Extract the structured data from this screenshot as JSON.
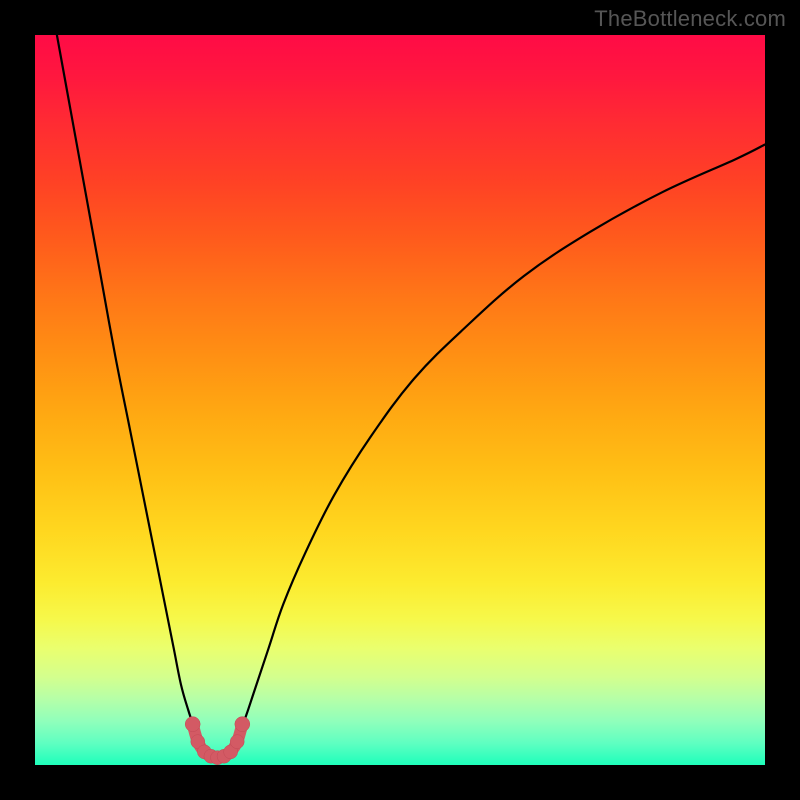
{
  "watermark": "TheBottleneck.com",
  "colors": {
    "frame": "#000000",
    "curve_stroke": "#000000",
    "marker_fill": "#d35a64",
    "marker_stroke": "#c34a56"
  },
  "chart_data": {
    "type": "line",
    "title": "",
    "xlabel": "",
    "ylabel": "",
    "xlim": [
      0,
      100
    ],
    "ylim": [
      0,
      100
    ],
    "grid": false,
    "note": "No axis labels or tick values are visible in the image. All x/y values below are estimated as percentages of the plot area (0 = left/bottom, 100 = right/top) read directly from the pixels.",
    "series": [
      {
        "name": "left-branch",
        "x": [
          3,
          5,
          7,
          9,
          11,
          13,
          15,
          17,
          18,
          19,
          20,
          21,
          22,
          22.7
        ],
        "y": [
          100,
          89,
          78,
          67,
          56,
          46,
          36,
          26,
          21,
          16,
          11,
          7.5,
          4.5,
          2.2
        ]
      },
      {
        "name": "right-branch",
        "x": [
          27.3,
          28,
          29,
          30,
          32,
          34,
          37,
          41,
          46,
          52,
          59,
          67,
          76,
          86,
          96,
          100
        ],
        "y": [
          2.2,
          4.2,
          7,
          10,
          16,
          22,
          29,
          37,
          45,
          53,
          60,
          67,
          73,
          78.5,
          83,
          85
        ]
      },
      {
        "name": "markers",
        "x": [
          21.6,
          22.3,
          23.2,
          24.1,
          25.0,
          25.9,
          26.8,
          27.7,
          28.4
        ],
        "y": [
          5.6,
          3.2,
          1.8,
          1.2,
          1.0,
          1.2,
          1.8,
          3.2,
          5.6
        ]
      }
    ],
    "minimum": {
      "x": 25.0,
      "y": 1.0
    }
  }
}
